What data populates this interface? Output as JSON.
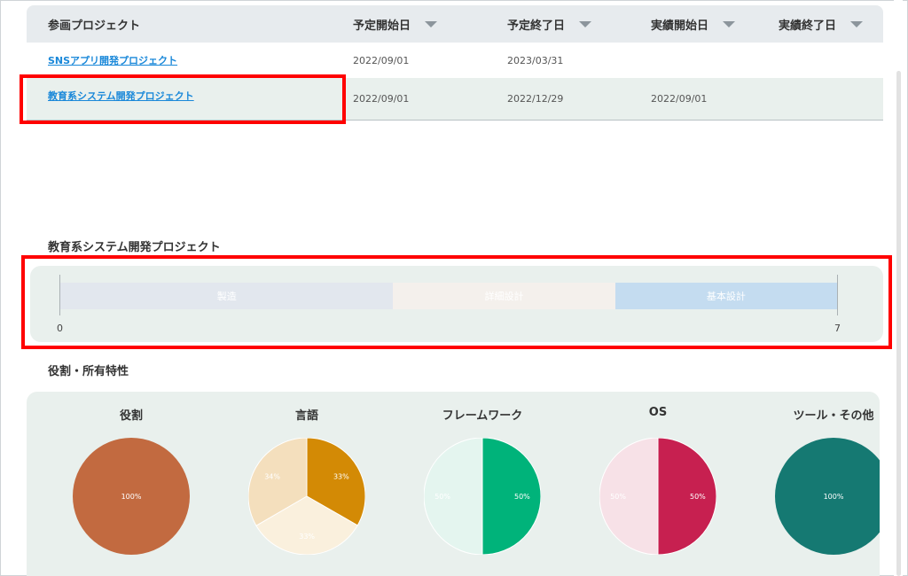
{
  "table": {
    "headers": [
      "参画プロジェクト",
      "予定開始日",
      "予定終了日",
      "実績開始日",
      "実績終了日"
    ],
    "rows": [
      {
        "project": "SNSアプリ開発プロジェクト",
        "plan_start": "2022/09/01",
        "plan_end": "2023/03/31",
        "actual_start": "",
        "actual_end": ""
      },
      {
        "project": "教育系システム開発プロジェクト",
        "plan_start": "2022/09/01",
        "plan_end": "2022/12/29",
        "actual_start": "2022/09/01",
        "actual_end": ""
      }
    ]
  },
  "gantt": {
    "title": "教育系システム開発プロジェクト",
    "axis_min": 0,
    "axis_max": 7,
    "axis_min_label": "0",
    "axis_max_label": "7",
    "phases": [
      {
        "label": "製造",
        "start": 0,
        "end": 3,
        "color": "#e2e7ee"
      },
      {
        "label": "詳細設計",
        "start": 3,
        "end": 5,
        "color": "#f4f0ec"
      },
      {
        "label": "基本設計",
        "start": 5,
        "end": 7,
        "color": "#c4dcf0"
      }
    ]
  },
  "traits": {
    "title": "役割・所有特性",
    "pies": [
      {
        "title": "役割",
        "slices": [
          {
            "value": 100,
            "label": "100%",
            "color": "#c26a40"
          }
        ]
      },
      {
        "title": "言語",
        "slices": [
          {
            "value": 33.3,
            "label": "33%",
            "color": "#d38a05"
          },
          {
            "value": 33.3,
            "label": "33%",
            "color": "#faf0dd"
          },
          {
            "value": 33.4,
            "label": "34%",
            "color": "#f4dfbd"
          }
        ]
      },
      {
        "title": "フレームワーク",
        "slices": [
          {
            "value": 50,
            "label": "50%",
            "color": "#00b37a"
          },
          {
            "value": 50,
            "label": "50%",
            "color": "#e4f5ef"
          }
        ]
      },
      {
        "title": "OS",
        "slices": [
          {
            "value": 50,
            "label": "50%",
            "color": "#c72050"
          },
          {
            "value": 50,
            "label": "50%",
            "color": "#f7e1e7"
          }
        ]
      },
      {
        "title": "ツール・その他",
        "slices": [
          {
            "value": 100,
            "label": "100%",
            "color": "#157972"
          }
        ]
      }
    ]
  }
}
